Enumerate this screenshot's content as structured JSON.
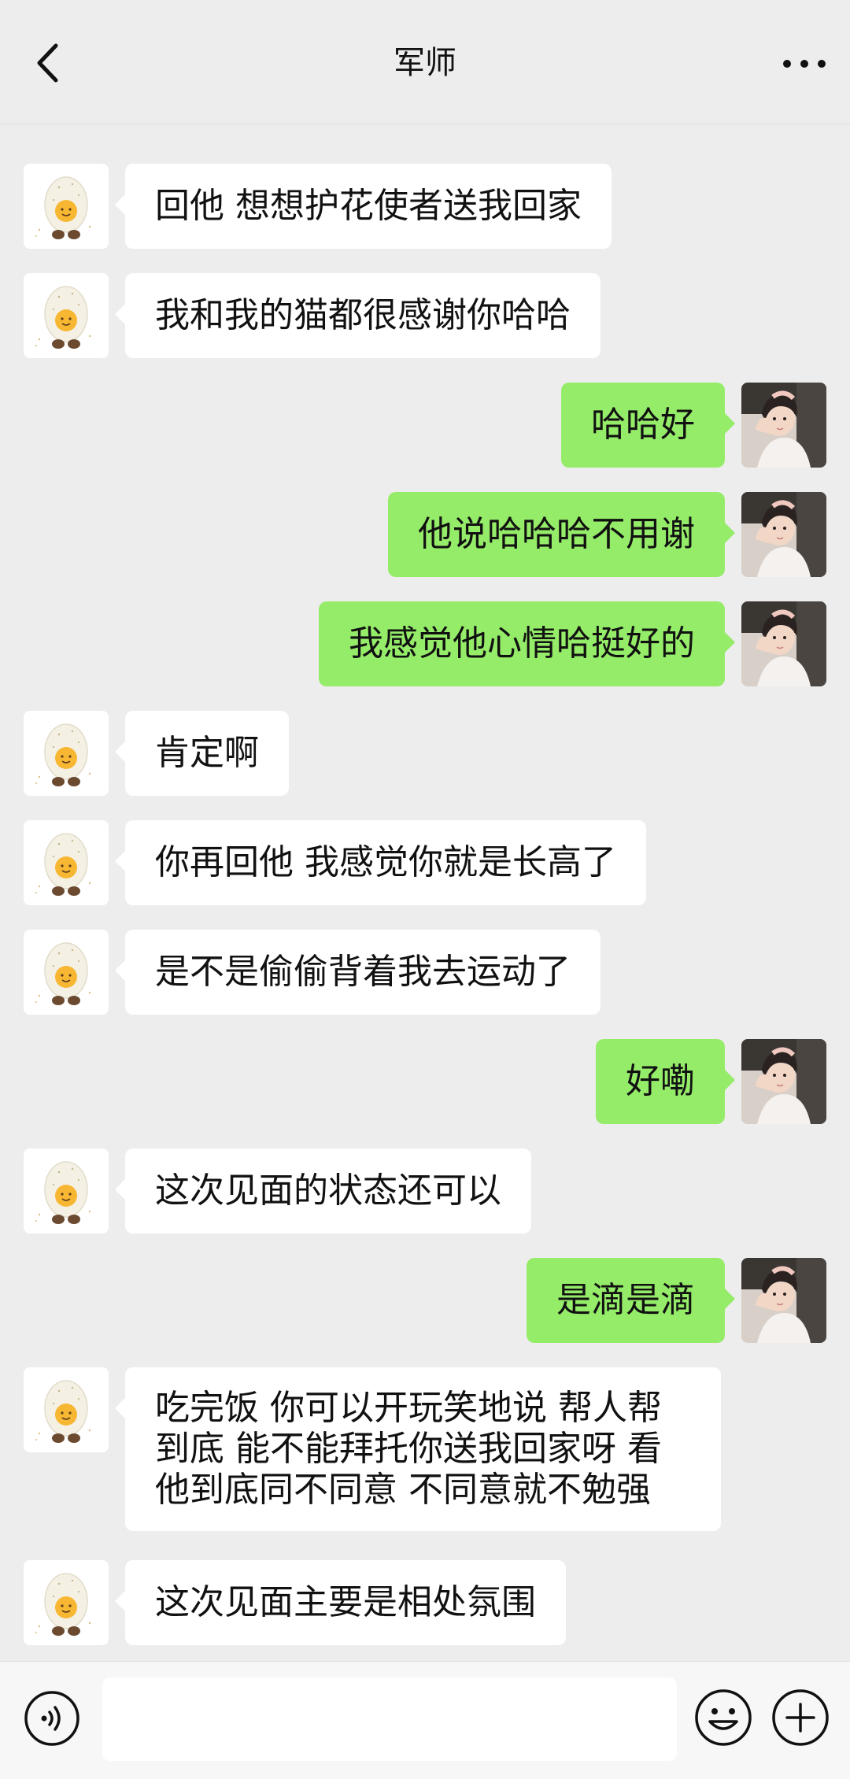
{
  "header": {
    "title": "军师",
    "back_icon": "chevron-left-icon",
    "more_icon": "more-horizontal-icon"
  },
  "colors": {
    "background": "#ededed",
    "sent_bubble": "#95ec69",
    "received_bubble": "#ffffff"
  },
  "messages": [
    {
      "direction": "out",
      "text": "",
      "partial": true
    },
    {
      "direction": "in",
      "text": "回他 想想护花使者送我回家"
    },
    {
      "direction": "in",
      "text": "我和我的猫都很感谢你哈哈"
    },
    {
      "direction": "out",
      "text": "哈哈好"
    },
    {
      "direction": "out",
      "text": "他说哈哈哈不用谢"
    },
    {
      "direction": "out",
      "text": "我感觉他心情哈挺好的"
    },
    {
      "direction": "in",
      "text": "肯定啊"
    },
    {
      "direction": "in",
      "text": "你再回他 我感觉你就是长高了"
    },
    {
      "direction": "in",
      "text": "是不是偷偷背着我去运动了"
    },
    {
      "direction": "out",
      "text": "好嘞"
    },
    {
      "direction": "in",
      "text": "这次见面的状态还可以"
    },
    {
      "direction": "out",
      "text": "是滴是滴"
    },
    {
      "direction": "in",
      "lines": [
        "吃完饭 你可以开玩笑地说 帮人帮",
        "到底 能不能拜托你送我回家呀 看",
        "他到底同不同意 不同意就不勉强"
      ]
    },
    {
      "direction": "in",
      "text": "这次见面主要是相处氛围"
    }
  ],
  "input_bar": {
    "voice_icon": "voice-icon",
    "input_value": "",
    "emoji_icon": "emoji-icon",
    "plus_icon": "plus-circle-icon"
  }
}
